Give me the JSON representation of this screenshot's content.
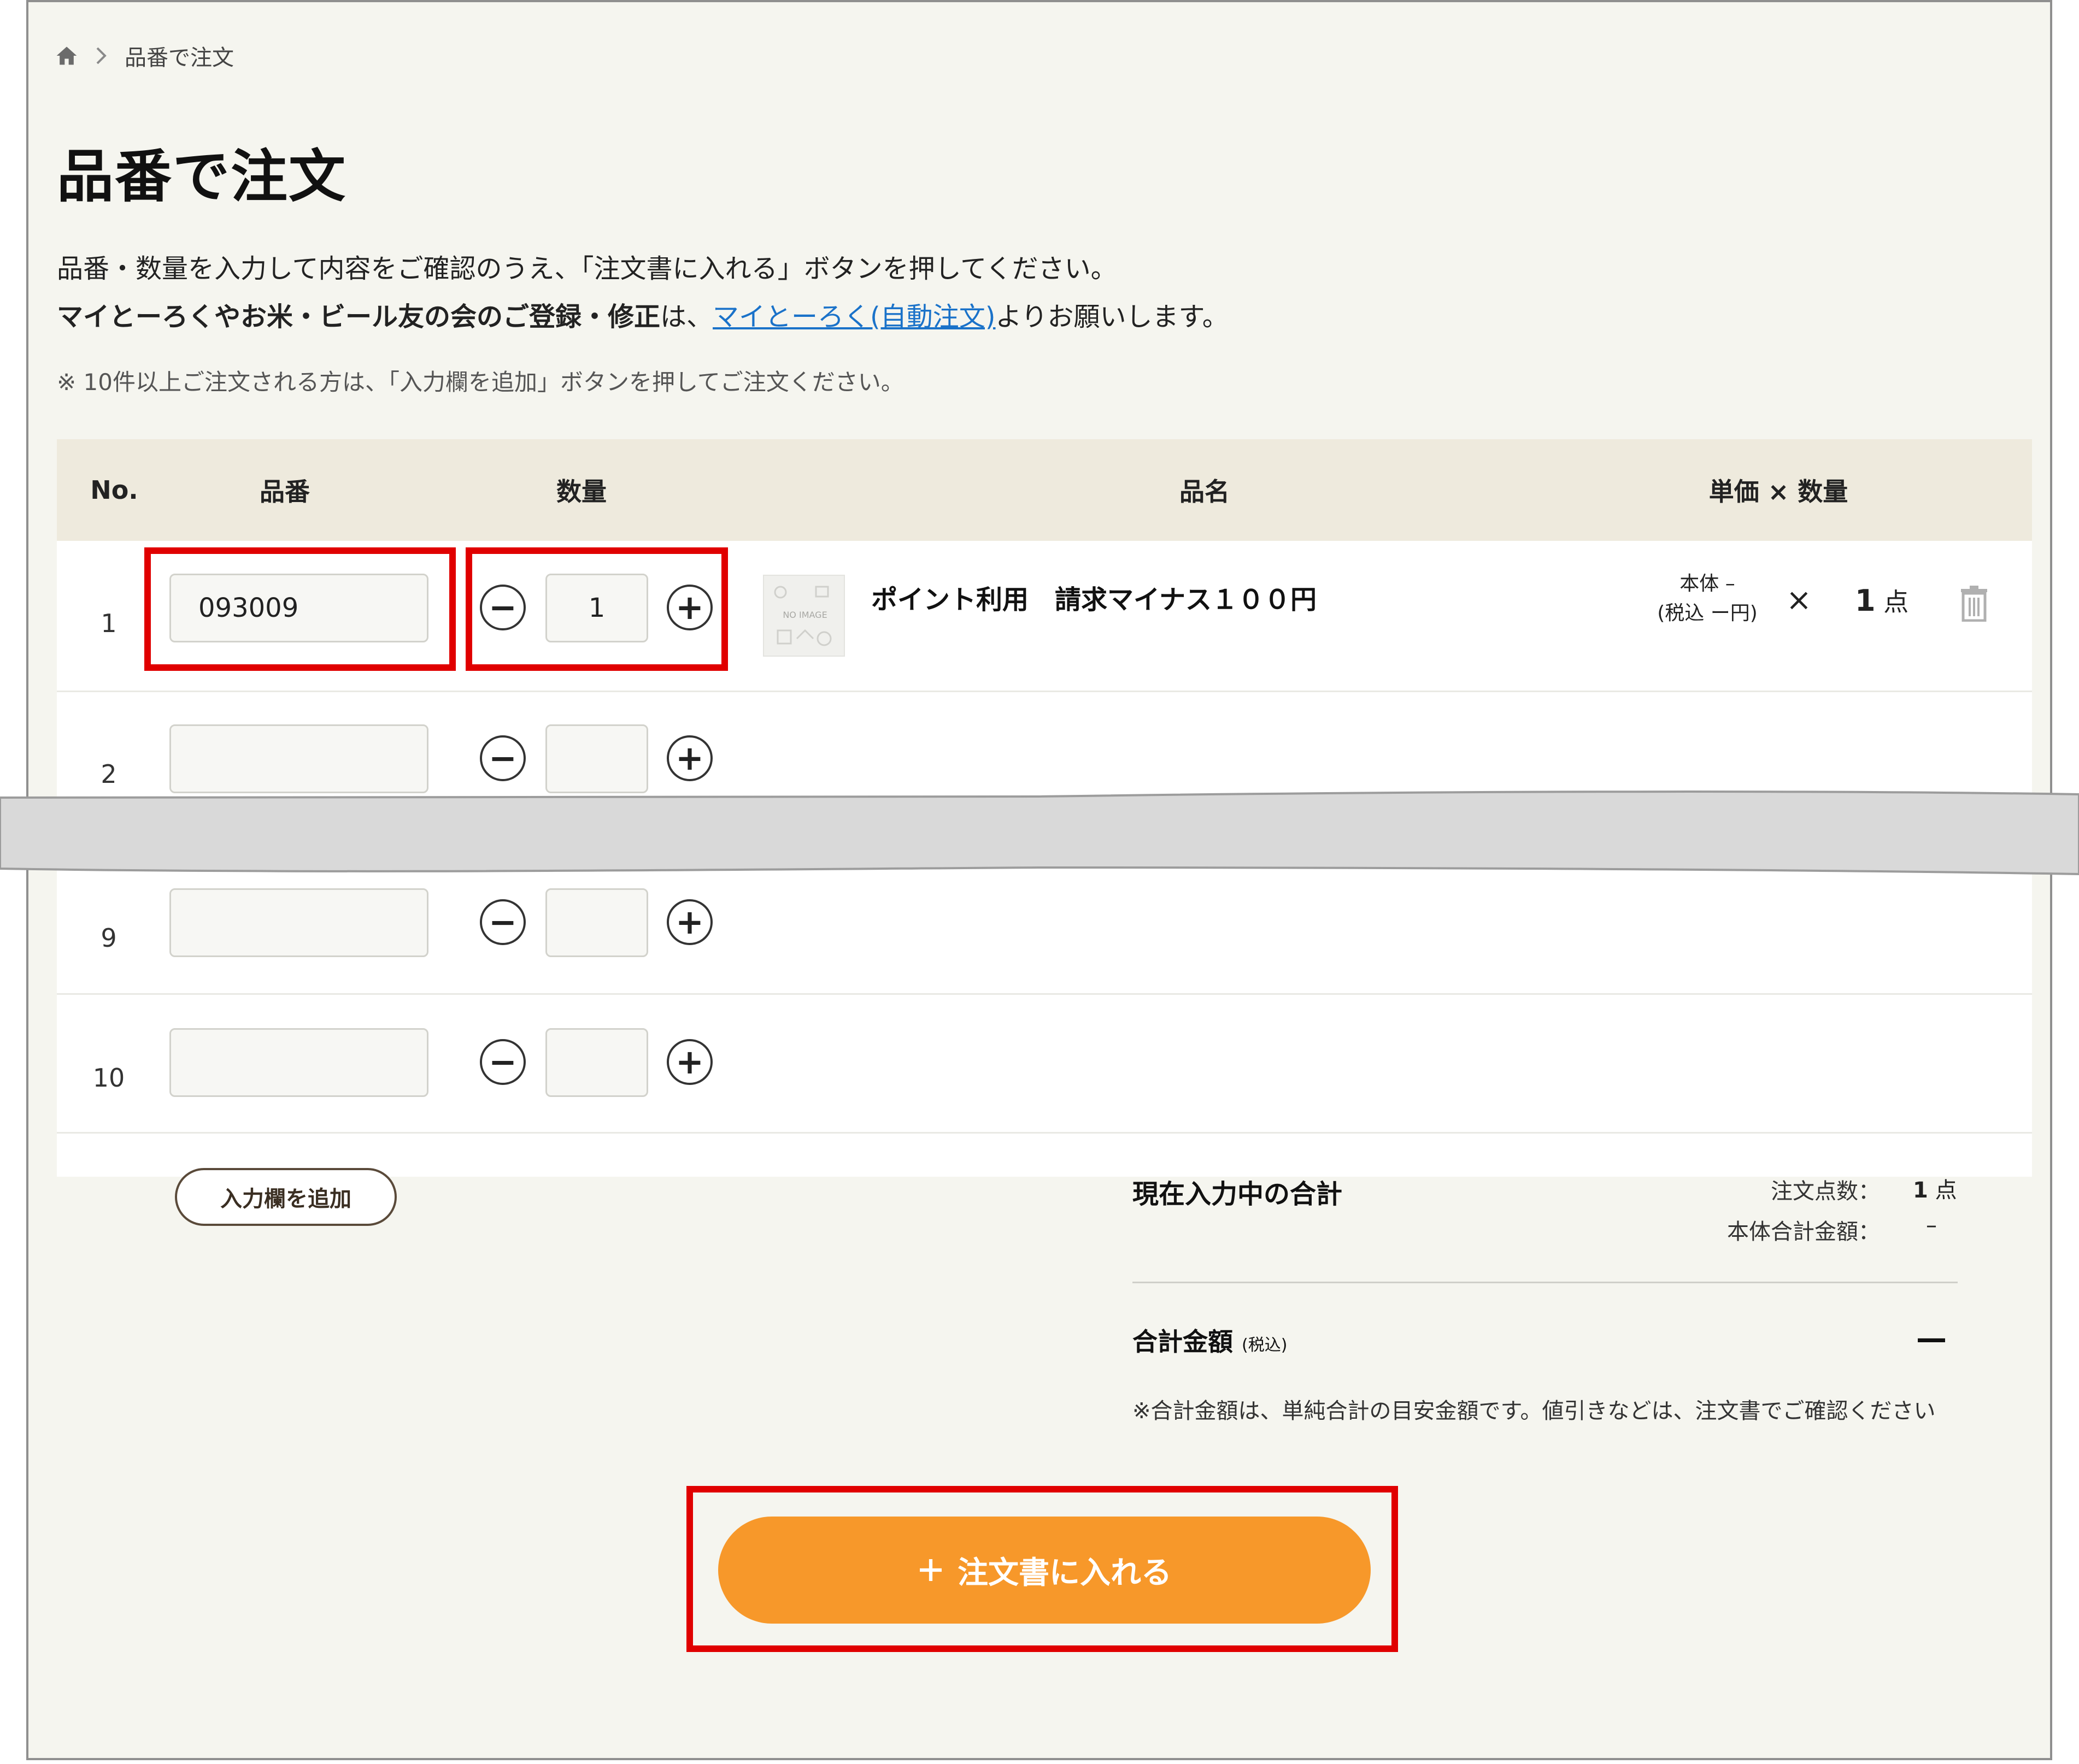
{
  "breadcrumb": {
    "home_icon": "home-icon",
    "separator_icon": "chevron-right-icon",
    "current": "品番で注文"
  },
  "page": {
    "title": "品番で注文",
    "description_line1": "品番・数量を入力して内容をご確認のうえ、「注文書に入れる」ボタンを押してください。",
    "description_line2_bold": "マイとーろくやお米・ビール友の会のご登録・修正",
    "description_line2_mid": "は、",
    "description_line2_link": "マイとーろく(自動注文)",
    "description_line2_end": "よりお願いします。",
    "note": "※ 10件以上ご注文される方は、「入力欄を追加」ボタンを押してご注文ください。"
  },
  "table": {
    "headers": {
      "no": "No.",
      "part_number": "品番",
      "quantity": "数量",
      "product_name": "品名",
      "price_qty": "単価 × 数量"
    },
    "rows": [
      {
        "no": "1",
        "part_number": "093009",
        "quantity": "1",
        "product_name": "ポイント利用　請求マイナス１００円",
        "price_line1": "本体 –",
        "price_line2": "(税込 ー円)",
        "times": "×",
        "count": "1",
        "count_unit": "点",
        "thumb_label": "NO IMAGE"
      },
      {
        "no": "2",
        "part_number": "",
        "quantity": ""
      },
      {
        "no": "9",
        "part_number": "",
        "quantity": ""
      },
      {
        "no": "10",
        "part_number": "",
        "quantity": ""
      }
    ],
    "minus_glyph": "−",
    "plus_glyph": "+"
  },
  "summary": {
    "add_button": "入力欄を追加",
    "title": "現在入力中の合計",
    "items_label": "注文点数：",
    "items_value": "1",
    "items_unit": "点",
    "subtotal_label": "本体合計金額：",
    "subtotal_value": "–",
    "total_label": "合計金額",
    "total_tax": "(税込)",
    "total_value": "—",
    "fine_print": "※合計金額は、単純合計の目安金額です。値引きなどは、注文書でご確認ください"
  },
  "submit": {
    "icon": "plus-icon",
    "label": "注文書に入れる"
  },
  "colors": {
    "accent": "#f7982a",
    "highlight": "#e00000",
    "link": "#1a72c9",
    "header_bg": "#eeeadd",
    "page_bg": "#f5f5ef"
  }
}
